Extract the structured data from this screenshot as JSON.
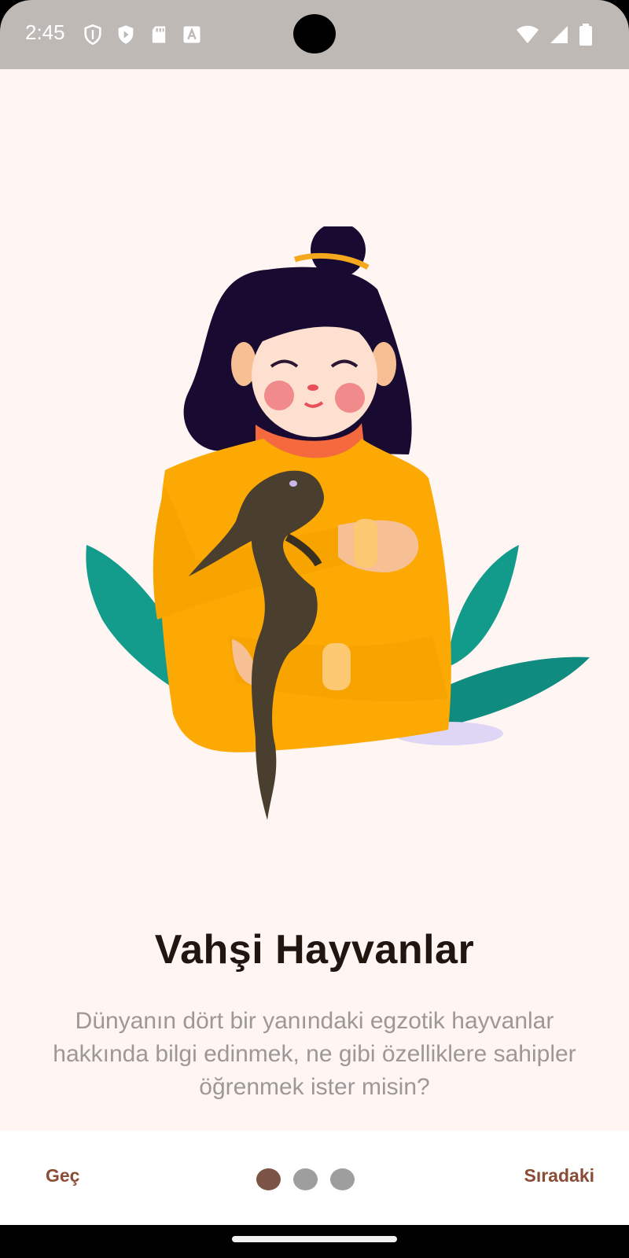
{
  "status_bar": {
    "time": "2:45",
    "left_icons": [
      "shield-icon",
      "play-protect-icon",
      "sd-card-icon",
      "a-text-icon"
    ],
    "right_icons": [
      "wifi-icon",
      "signal-icon",
      "battery-icon"
    ]
  },
  "onboarding": {
    "title": "Vahşi Hayvanlar",
    "description": "Dünyanın dört bir yanındaki egzotik hayvanlar hakkında bilgi edinmek, ne gibi özelliklere sahipler öğrenmek ister misin?",
    "illustration": "girl-holding-lizard-illustration"
  },
  "bottom_bar": {
    "skip_label": "Geç",
    "next_label": "Sıradaki",
    "page_indicator": {
      "total": 3,
      "current": 1
    }
  },
  "colors": {
    "background": "#fff6f4",
    "accent": "#8a4c35",
    "dot_active": "#7b5445",
    "dot_inactive": "#9e9e9e",
    "title": "#22140f",
    "description": "#9c9896"
  }
}
